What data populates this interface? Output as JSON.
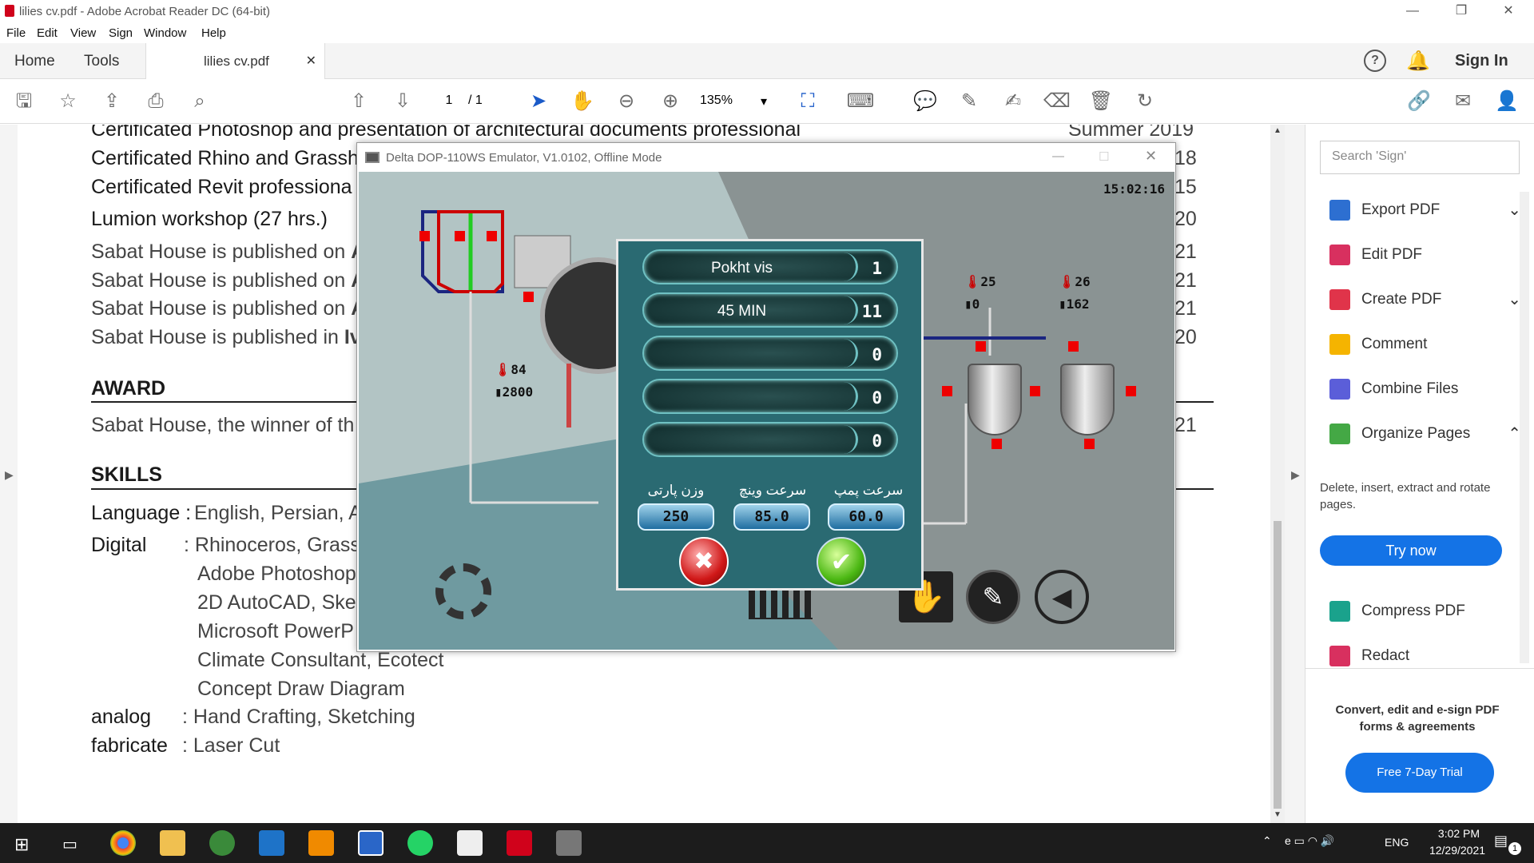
{
  "window": {
    "title": "lilies cv.pdf - Adobe Acrobat Reader DC (64-bit)"
  },
  "menu": [
    "File",
    "Edit",
    "View",
    "Sign",
    "Window",
    "Help"
  ],
  "tabs": {
    "home": "Home",
    "tools": "Tools",
    "doc": "lilies cv.pdf",
    "sign_in": "Sign In"
  },
  "toolbar": {
    "page_current": "1",
    "page_total": "/ 1",
    "zoom": "135%"
  },
  "cv": {
    "lines_top": [
      {
        "text": "Certificated Photoshop and presentation of architectural documents professional",
        "date": "Summer 2019"
      },
      {
        "text": "Certificated Rhino and Grassh",
        "date": "18"
      },
      {
        "text": "Certificated Revit professiona",
        "date": "15"
      },
      {
        "text": "Lumion workshop (27 hrs.)",
        "date": "20"
      }
    ],
    "published": [
      {
        "text": "Sabat House is published on ",
        "bold": "A",
        "date": "21"
      },
      {
        "text": "Sabat House is published on ",
        "bold": "A",
        "date": "21"
      },
      {
        "text": "Sabat House is published on ",
        "bold": "A",
        "date": "21"
      },
      {
        "text": "Sabat House is published in ",
        "bold": "Iv",
        "date": "20"
      }
    ],
    "award_heading": "AWARD",
    "award_text": "Sabat House, the winner of th",
    "award_date": "21",
    "skills_heading": "SKILLS",
    "skills": [
      {
        "key": "Language :",
        "val": "English, Persian, A"
      },
      {
        "key": "Digital",
        "val": ": Rhinoceros, Grass"
      },
      {
        "key": "",
        "val": "Adobe Photoshop"
      },
      {
        "key": "",
        "val": "2D AutoCAD, Sket"
      },
      {
        "key": "",
        "val": "Microsoft PowerP"
      },
      {
        "key": "",
        "val": "Climate Consultant, Ecotect"
      },
      {
        "key": "",
        "val": "Concept Draw Diagram"
      },
      {
        "key": "analog",
        "val": ":  Hand Crafting, Sketching"
      },
      {
        "key": "fabricate",
        "val": ":  Laser Cut"
      }
    ]
  },
  "right_panel": {
    "search_placeholder": "Search 'Sign'",
    "items": [
      {
        "label": "Export PDF",
        "color": "#2d6fd1",
        "expand": "⌄"
      },
      {
        "label": "Edit PDF",
        "color": "#d8305f",
        "expand": ""
      },
      {
        "label": "Create PDF",
        "color": "#e0344a",
        "expand": "⌄"
      },
      {
        "label": "Comment",
        "color": "#f5b400",
        "expand": ""
      },
      {
        "label": "Combine Files",
        "color": "#5b5ed9",
        "expand": ""
      },
      {
        "label": "Organize Pages",
        "color": "#44a845",
        "expand": "⌃"
      }
    ],
    "organize_desc": "Delete, insert, extract and rotate pages.",
    "try_now": "Try now",
    "items2": [
      {
        "label": "Compress PDF",
        "color": "#1aa28c"
      },
      {
        "label": "Redact",
        "color": "#d8305f"
      }
    ],
    "promo": "Convert, edit and e-sign PDF forms & agreements",
    "trial": "Free 7-Day Trial"
  },
  "emulator": {
    "title": "Delta DOP-110WS Emulator, V1.0102, Offline Mode",
    "clock": "15:02:16",
    "dialog_rows": [
      {
        "label": "Pokht vis",
        "num": "1"
      },
      {
        "label": "45 MIN",
        "num": "11"
      },
      {
        "label": "",
        "num": "0"
      },
      {
        "label": "",
        "num": "0"
      },
      {
        "label": "",
        "num": "0"
      }
    ],
    "fields": [
      {
        "label": "وزن پارتی",
        "value": "250"
      },
      {
        "label": "سرعت وینچ",
        "value": "85.0"
      },
      {
        "label": "سرعت پمپ",
        "value": "60.0"
      }
    ],
    "sensors": [
      {
        "t": "84",
        "p": "2800"
      },
      {
        "t": "25",
        "p": "0"
      },
      {
        "t": "26",
        "p": "162"
      }
    ]
  },
  "taskbar": {
    "lang": "ENG",
    "time": "3:02 PM",
    "date": "12/29/2021",
    "notif": "1"
  }
}
